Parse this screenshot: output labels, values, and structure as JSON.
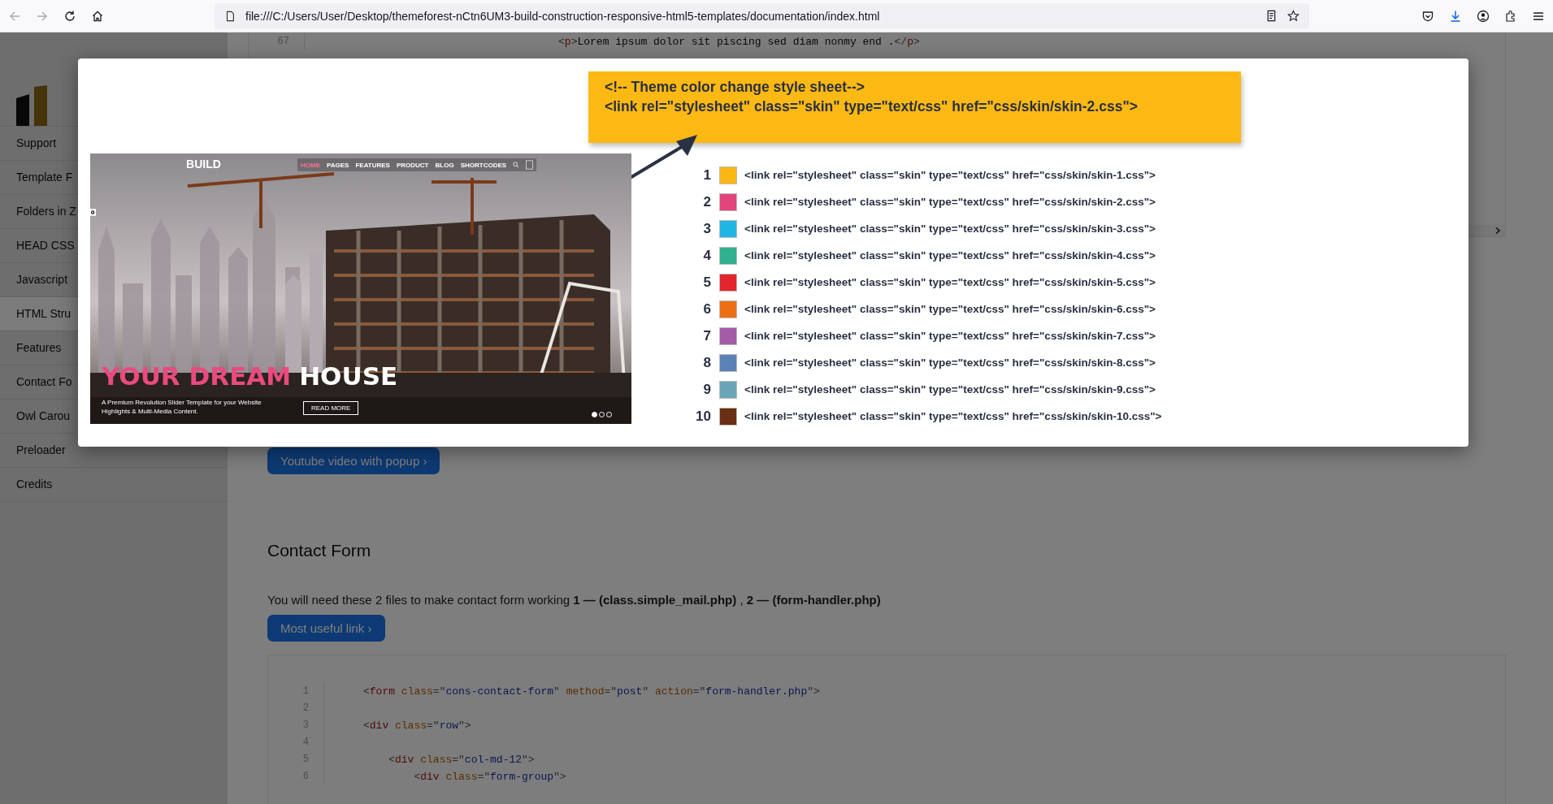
{
  "browser": {
    "url": "file:///C:/Users/User/Desktop/themeforest-nCtn6UM3-build-construction-responsive-html5-templates/documentation/index.html",
    "back_disabled": true,
    "forward_disabled": true
  },
  "sidebar": {
    "items": [
      {
        "label": "Support",
        "selected": false
      },
      {
        "label": "Template F",
        "selected": false
      },
      {
        "label": "Folders in Z",
        "selected": false
      },
      {
        "label": "HEAD CSS",
        "selected": false
      },
      {
        "label": "Javascript",
        "selected": false
      },
      {
        "label": "HTML Stru",
        "selected": true
      },
      {
        "label": "Features",
        "selected": false
      },
      {
        "label": "Contact Fo",
        "selected": false
      },
      {
        "label": "Owl Carou",
        "selected": false
      },
      {
        "label": "Preloader",
        "selected": false
      },
      {
        "label": "Credits",
        "selected": false
      }
    ]
  },
  "top_code": {
    "lines": [
      {
        "number": "67",
        "tokens": [
          {
            "kind": "punct",
            "text": "<"
          },
          {
            "kind": "tag",
            "text": "p"
          },
          {
            "kind": "punct",
            "text": ">"
          },
          {
            "kind": "text",
            "text": "Lorem ipsum dolor sit piscing sed diam nonmy end ."
          },
          {
            "kind": "punct",
            "text": "</"
          },
          {
            "kind": "tag",
            "text": "p"
          },
          {
            "kind": "punct",
            "text": ">"
          }
        ]
      }
    ]
  },
  "youtube_button": "Youtube video with popup ›",
  "section": {
    "title": "Contact Form",
    "text": "You will need these 2 files to make contact form working **1 — (class.simple_mail.php)** , **2 — (form-handler.php)**",
    "button": "Most useful link ›"
  },
  "code": {
    "lines": [
      {
        "number": "1",
        "tokens": [
          {
            "kind": "punct",
            "text": "<"
          },
          {
            "kind": "tag",
            "text": "form"
          },
          {
            "kind": "attr",
            "text": " class"
          },
          {
            "kind": "punct",
            "text": "=\""
          },
          {
            "kind": "value",
            "text": "cons-contact-form"
          },
          {
            "kind": "punct",
            "text": "\""
          },
          {
            "kind": "attr",
            "text": " method"
          },
          {
            "kind": "punct",
            "text": "=\""
          },
          {
            "kind": "value",
            "text": "post"
          },
          {
            "kind": "punct",
            "text": "\""
          },
          {
            "kind": "attr",
            "text": " action"
          },
          {
            "kind": "punct",
            "text": "=\""
          },
          {
            "kind": "value",
            "text": "form-handler.php"
          },
          {
            "kind": "punct",
            "text": "\">"
          }
        ]
      },
      {
        "number": "2"
      },
      {
        "number": "3",
        "tokens": [
          {
            "kind": "punct",
            "text": "<"
          },
          {
            "kind": "tag",
            "text": "div"
          },
          {
            "kind": "attr",
            "text": " class"
          },
          {
            "kind": "punct",
            "text": "=\""
          },
          {
            "kind": "value",
            "text": "row"
          },
          {
            "kind": "punct",
            "text": "\">"
          }
        ],
        "children": [
          {
            "number": "4"
          },
          {
            "number": "5",
            "tokens": [
              {
                "kind": "punct",
                "text": "<"
              },
              {
                "kind": "tag",
                "text": "div"
              },
              {
                "kind": "attr",
                "text": " class"
              },
              {
                "kind": "punct",
                "text": "=\""
              },
              {
                "kind": "value",
                "text": "col-md-12"
              },
              {
                "kind": "punct",
                "text": "\">"
              }
            ],
            "children": [
              {
                "number": "6",
                "tokens": [
                  {
                    "kind": "punct",
                    "text": "<"
                  },
                  {
                    "kind": "tag",
                    "text": "div"
                  },
                  {
                    "kind": "attr",
                    "text": " class"
                  },
                  {
                    "kind": "punct",
                    "text": "=\""
                  },
                  {
                    "kind": "value",
                    "text": "form-group"
                  },
                  {
                    "kind": "punct",
                    "text": "\">"
                  }
                ]
              }
            ]
          }
        ]
      }
    ]
  },
  "modal": {
    "hero": {
      "logo": "B**U**ILD",
      "nav": [
        {
          "label": "HOME",
          "selected": true
        },
        {
          "label": "PAGES",
          "selected": false
        },
        {
          "label": "FEATURES",
          "selected": false
        },
        {
          "label": "PRODUCT",
          "selected": false
        },
        {
          "label": "BLOG",
          "selected": false
        },
        {
          "label": "SHORTCODES",
          "selected": false
        }
      ],
      "headline_accent": "YOUR DREAM",
      "headline": "HOUSE",
      "subtitle": "A Premium Revolution Slider Template for your Website Highlights & Multi-Media Content.",
      "button": "READ MORE",
      "dots": [
        {
          "selected": true
        },
        {
          "selected": false
        },
        {
          "selected": false
        }
      ]
    },
    "callout": {
      "comment": "<!-- Theme color change style sheet-->",
      "code": "<link rel=\"stylesheet\" class=\"skin\" type=\"text/css\" href=\"css/skin/skin-2.css\">"
    },
    "skins": [
      {
        "number": "1",
        "color": "#fbb714",
        "code": "<link rel=\"stylesheet\" class=\"skin\" type=\"text/css\" href=\"css/skin/skin-1.css\">"
      },
      {
        "number": "2",
        "color": "#e2447c",
        "code": "<link rel=\"stylesheet\" class=\"skin\" type=\"text/css\" href=\"css/skin/skin-2.css\">"
      },
      {
        "number": "3",
        "color": "#20b6e4",
        "code": "<link rel=\"stylesheet\" class=\"skin\" type=\"text/css\" href=\"css/skin/skin-3.css\">"
      },
      {
        "number": "4",
        "color": "#2fb08f",
        "code": "<link rel=\"stylesheet\" class=\"skin\" type=\"text/css\" href=\"css/skin/skin-4.css\">"
      },
      {
        "number": "5",
        "color": "#e3262e",
        "code": "<link rel=\"stylesheet\" class=\"skin\" type=\"text/css\" href=\"css/skin/skin-5.css\">"
      },
      {
        "number": "6",
        "color": "#ec6f16",
        "code": "<link rel=\"stylesheet\" class=\"skin\" type=\"text/css\" href=\"css/skin/skin-6.css\">"
      },
      {
        "number": "7",
        "color": "#a45ca8",
        "code": "<link rel=\"stylesheet\" class=\"skin\" type=\"text/css\" href=\"css/skin/skin-7.css\">"
      },
      {
        "number": "8",
        "color": "#5b82b7",
        "code": "<link rel=\"stylesheet\" class=\"skin\" type=\"text/css\" href=\"css/skin/skin-8.css\">"
      },
      {
        "number": "9",
        "color": "#6aa5b8",
        "code": "<link rel=\"stylesheet\" class=\"skin\" type=\"text/css\" href=\"css/skin/skin-9.css\">"
      },
      {
        "number": "10",
        "color": "#6b2f16",
        "code": "<link rel=\"stylesheet\" class=\"skin\" type=\"text/css\" href=\"css/skin/skin-10.css\">"
      }
    ]
  }
}
